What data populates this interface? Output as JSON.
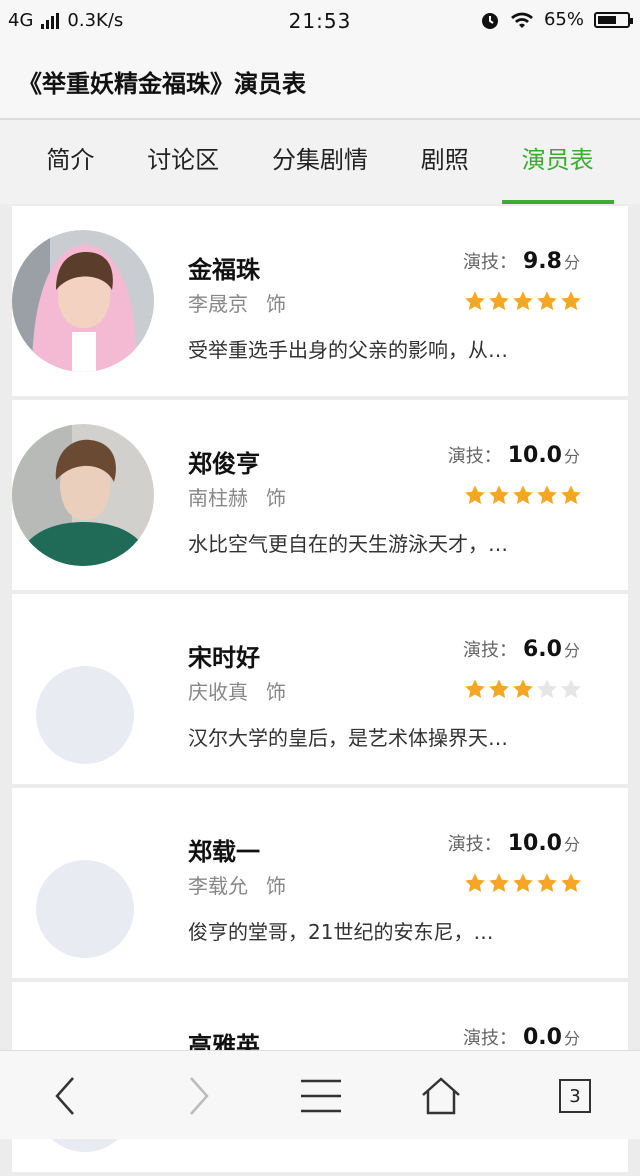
{
  "status": {
    "network": "4G",
    "speed": "0.3K/s",
    "time": "21:53",
    "battery": "65%",
    "battery_level": 0.65
  },
  "title": "《举重妖精金福珠》演员表",
  "tabs": [
    {
      "label": "简介",
      "active": false
    },
    {
      "label": "讨论区",
      "active": false
    },
    {
      "label": "分集剧情",
      "active": false
    },
    {
      "label": "剧照",
      "active": false
    },
    {
      "label": "演员表",
      "active": true
    }
  ],
  "score_label": "演技：",
  "score_unit": "分",
  "as_label": "饰",
  "cast": [
    {
      "name": "金福珠",
      "actor": "李晟京",
      "score": "9.8",
      "stars": 5,
      "desc": "受举重选手出身的父亲的影响，从…",
      "avatar": "photo-woman-pink-hoodie"
    },
    {
      "name": "郑俊亨",
      "actor": "南柱赫",
      "score": "10.0",
      "stars": 5,
      "desc": "水比空气更自在的天生游泳天才，…",
      "avatar": "photo-man-green-jacket"
    },
    {
      "name": "宋时好",
      "actor": "庆收真",
      "score": "6.0",
      "stars": 3,
      "desc": "汉尔大学的皇后，是艺术体操界天…",
      "avatar": "placeholder"
    },
    {
      "name": "郑载一",
      "actor": "李载允",
      "score": "10.0",
      "stars": 5,
      "desc": "俊亨的堂哥，21世纪的安东尼，…",
      "avatar": "placeholder"
    },
    {
      "name": "高雅英",
      "actor": "",
      "score": "0.0",
      "stars": 0,
      "desc": "",
      "avatar": "placeholder"
    }
  ],
  "bottom_nav": {
    "tab_count": "3"
  },
  "colors": {
    "accent": "#3dab32",
    "star": "#f5a623",
    "star_empty": "#e6e6e6"
  }
}
